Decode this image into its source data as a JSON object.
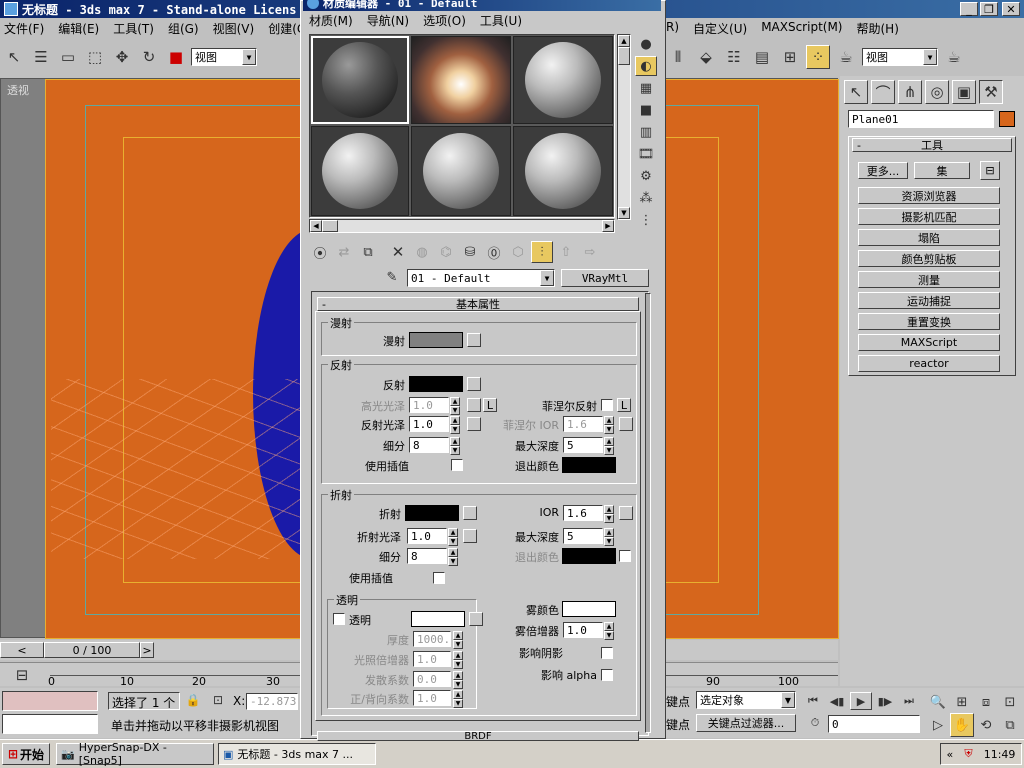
{
  "main": {
    "title": "无标题 - 3ds max 7  - Stand-alone Licens",
    "menu": [
      "文件(F)",
      "编辑(E)",
      "工具(T)",
      "组(G)",
      "视图(V)",
      "创建(C)"
    ],
    "menu_right": [
      "R)",
      "自定义(U)",
      "MAXScript(M)",
      "帮助(H)"
    ],
    "view_dropdown": "视图",
    "view_dropdown2": "视图",
    "viewport_label": "透视"
  },
  "material_editor": {
    "title": "材质编辑器 - 01 - Default",
    "menu": [
      "材质(M)",
      "导航(N)",
      "选项(O)",
      "工具(U)"
    ],
    "material_name": "01 - Default",
    "material_type": "VRayMtl",
    "rollout_title": "基本属性",
    "diffuse": {
      "group": "漫射",
      "label": "漫射",
      "color": "#808080"
    },
    "reflection": {
      "group": "反射",
      "reflect_label": "反射",
      "hilight_gloss_label": "高光光泽",
      "hilight_gloss_value": "1.0",
      "lock": "L",
      "fresnel_label": "菲涅尔反射",
      "fresnel_lock": "L",
      "refl_gloss_label": "反射光泽",
      "refl_gloss_value": "1.0",
      "fresnel_ior_label": "菲涅尔 IOR",
      "fresnel_ior_value": "1.6",
      "subdivs_label": "细分",
      "subdivs_value": "8",
      "max_depth_label": "最大深度",
      "max_depth_value": "5",
      "use_interp_label": "使用插值",
      "exit_color_label": "退出颜色"
    },
    "refraction": {
      "group": "折射",
      "refract_label": "折射",
      "ior_label": "IOR",
      "ior_value": "1.6",
      "gloss_label": "折射光泽",
      "gloss_value": "1.0",
      "max_depth_label": "最大深度",
      "max_depth_value": "5",
      "subdivs_label": "细分",
      "subdivs_value": "8",
      "exit_color_label": "退出颜色",
      "use_interp_label": "使用插值"
    },
    "translucency": {
      "group": "透明",
      "checkbox_label": "透明",
      "thickness_label": "厚度",
      "thickness_value": "1000.0",
      "light_mult_label": "光照倍增器",
      "light_mult_value": "1.0",
      "scatter_label": "发散系数",
      "scatter_value": "0.0",
      "fwd_back_label": "正/背向系数",
      "fwd_back_value": "1.0"
    },
    "fog": {
      "color_label": "雾颜色",
      "mult_label": "雾倍增器",
      "mult_value": "1.0",
      "affect_shadows_label": "影响阴影",
      "affect_alpha_label": "影响 alpha"
    },
    "brdf_label": "BRDF"
  },
  "command_panel": {
    "object_name": "Plane01",
    "utilities_title": "工具",
    "more_label": "更多...",
    "sets_label": "集",
    "buttons": [
      "资源浏览器",
      "摄影机匹配",
      "塌陷",
      "颜色剪贴板",
      "测量",
      "运动捕捉",
      "重置变换",
      "MAXScript",
      "reactor"
    ]
  },
  "timeline": {
    "position": "0 / 100",
    "ticks": [
      "0",
      "10",
      "20",
      "30",
      "90",
      "100"
    ]
  },
  "status": {
    "selected": "选择了 1 个",
    "x_label": "X:",
    "x_value": "-12.873",
    "prompt": "单击并拖动以平移非摄影机视图",
    "key_label1": "键点",
    "key_label2": "键点",
    "selection_set": "选定对象",
    "key_filters": "关键点过滤器...",
    "frame_value": "0"
  },
  "taskbar": {
    "start": "开始",
    "task1": "HyperSnap-DX - [Snap5]",
    "task2": "无标题 - 3ds max 7 ...",
    "clock": "11:49"
  },
  "colors": {
    "viewport_orange": "#d6661c",
    "sphere_blue": "#1a1aa8",
    "title_blue": "#0a246a"
  }
}
